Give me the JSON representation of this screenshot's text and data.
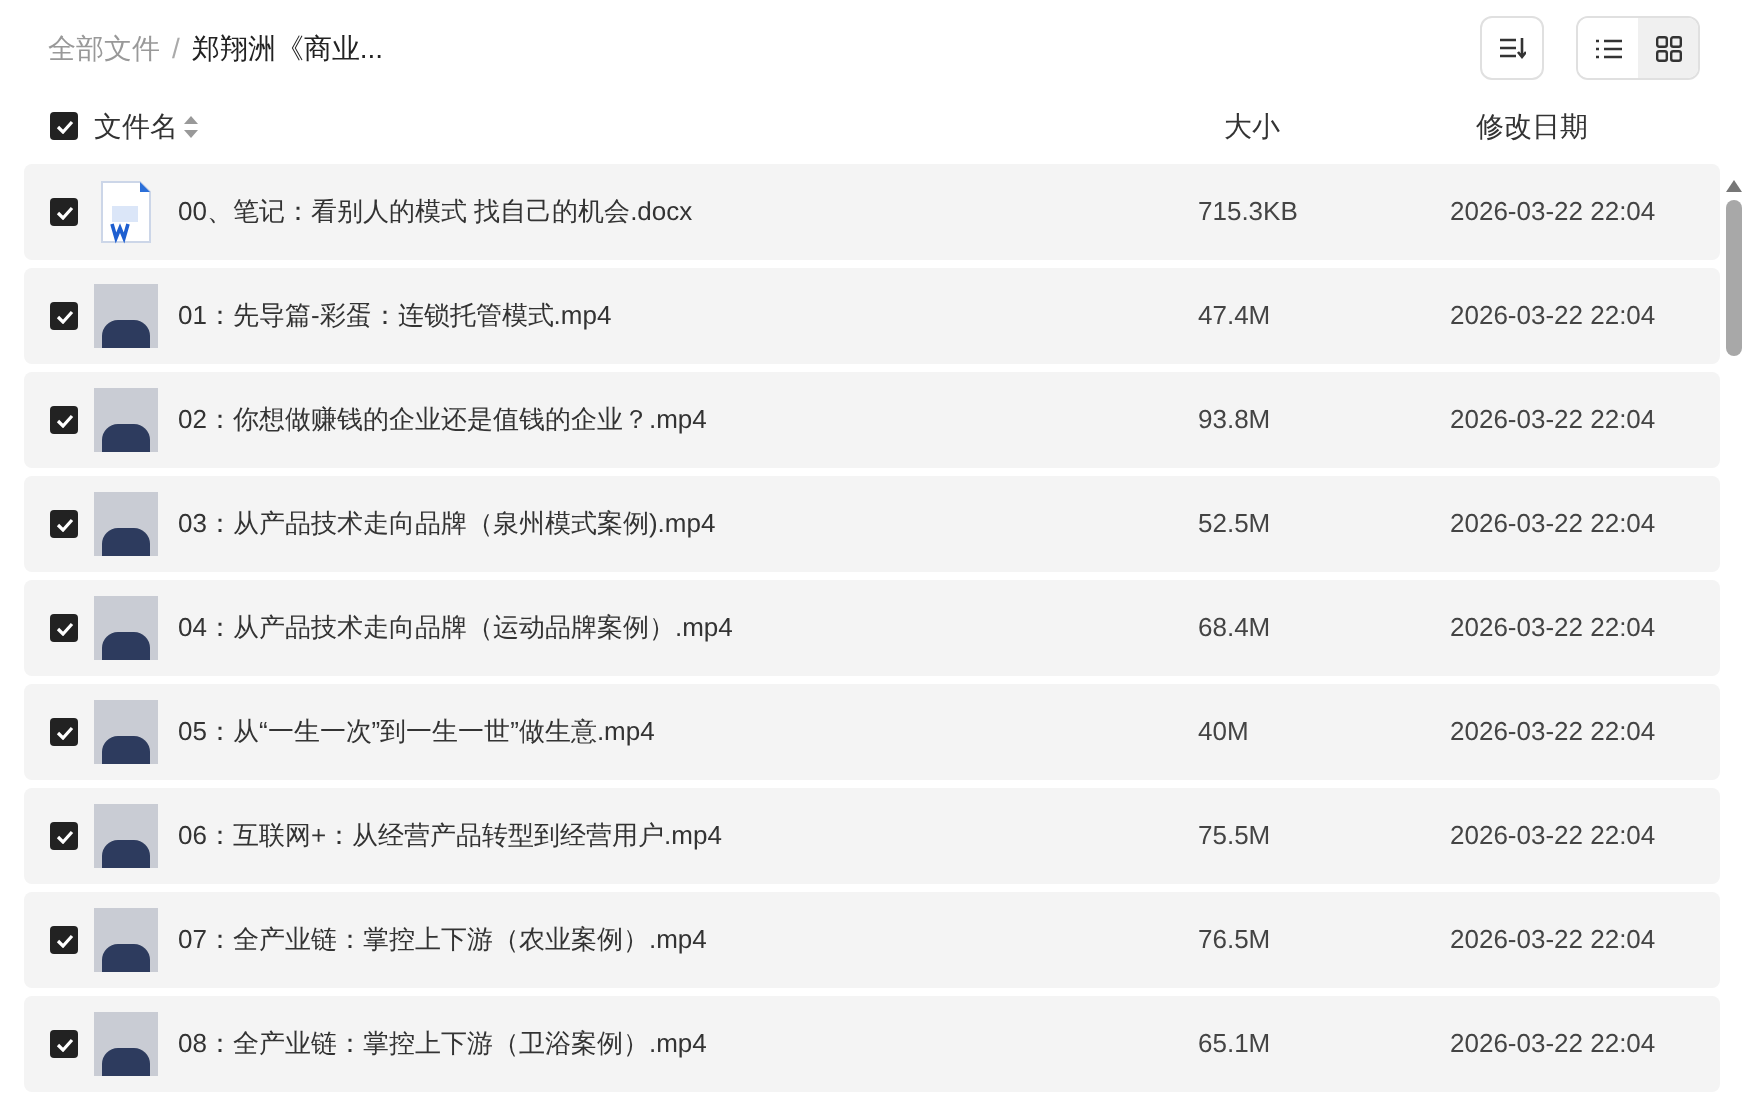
{
  "breadcrumb": [
    {
      "label": "全部文件",
      "current": false
    },
    {
      "label": "郑翔洲《商业...",
      "current": true
    }
  ],
  "breadcrumb_separator": "/",
  "view_modes": [
    {
      "kind": "list",
      "selected": true
    },
    {
      "kind": "grid",
      "selected": false
    }
  ],
  "table": {
    "select_all": {
      "checked": true
    },
    "columns": [
      "文件名",
      "大小",
      "修改日期"
    ],
    "rows": [
      {
        "kind": "docx",
        "checked": true,
        "name": "00、笔记：看别人的模式 找自己的机会.docx",
        "size": "715.3KB",
        "modified": "2026-03-22 22:04"
      },
      {
        "kind": "video",
        "checked": true,
        "name": "01：先导篇-彩蛋：连锁托管模式.mp4",
        "size": "47.4M",
        "modified": "2026-03-22 22:04"
      },
      {
        "kind": "video",
        "checked": true,
        "name": "02：你想做赚钱的企业还是值钱的企业？.mp4",
        "size": "93.8M",
        "modified": "2026-03-22 22:04"
      },
      {
        "kind": "video",
        "checked": true,
        "name": "03：从产品技术走向品牌（泉州模式案例).mp4",
        "size": "52.5M",
        "modified": "2026-03-22 22:04"
      },
      {
        "kind": "video",
        "checked": true,
        "name": "04：从产品技术走向品牌（运动品牌案例）.mp4",
        "size": "68.4M",
        "modified": "2026-03-22 22:04"
      },
      {
        "kind": "video",
        "checked": true,
        "name": "05：从“一生一次”到一生一世”做生意.mp4",
        "size": "40M",
        "modified": "2026-03-22 22:04"
      },
      {
        "kind": "video",
        "checked": true,
        "name": "06：互联网+：从经营产品转型到经营用户.mp4",
        "size": "75.5M",
        "modified": "2026-03-22 22:04"
      },
      {
        "kind": "video",
        "checked": true,
        "name": "07：全产业链：掌控上下游（农业案例）.mp4",
        "size": "76.5M",
        "modified": "2026-03-22 22:04"
      },
      {
        "kind": "video",
        "checked": true,
        "name": "08：全产业链：掌控上下游（卫浴案例）.mp4",
        "size": "65.1M",
        "modified": "2026-03-22 22:04"
      }
    ]
  }
}
